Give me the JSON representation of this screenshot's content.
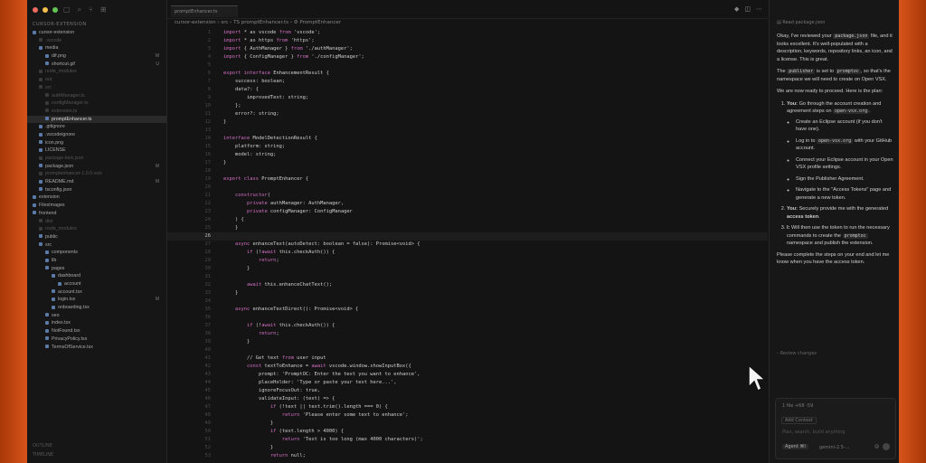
{
  "explorer": {
    "header": "CURSOR-EXTENSION",
    "root": "cursor-extension",
    "items": [
      {
        "label": "cursor-extension",
        "indent": 0,
        "dim": false,
        "badge": "",
        "sel": false
      },
      {
        "label": ".vscode",
        "indent": 1,
        "dim": true,
        "badge": "",
        "sel": false
      },
      {
        "label": "media",
        "indent": 1,
        "dim": false,
        "badge": "",
        "sel": false
      },
      {
        "label": "dif.png",
        "indent": 2,
        "dim": false,
        "badge": "M",
        "sel": false
      },
      {
        "label": "shortcut.gif",
        "indent": 2,
        "dim": false,
        "badge": "U",
        "sel": false
      },
      {
        "label": "node_modules",
        "indent": 1,
        "dim": true,
        "badge": "",
        "sel": false
      },
      {
        "label": "out",
        "indent": 1,
        "dim": true,
        "badge": "",
        "sel": false
      },
      {
        "label": "src",
        "indent": 1,
        "dim": true,
        "badge": "",
        "sel": false
      },
      {
        "label": "authManager.ts",
        "indent": 2,
        "dim": true,
        "badge": "",
        "sel": false
      },
      {
        "label": "configManager.ts",
        "indent": 2,
        "dim": true,
        "badge": "",
        "sel": false
      },
      {
        "label": "extension.ts",
        "indent": 2,
        "dim": true,
        "badge": "",
        "sel": false
      },
      {
        "label": "promptEnhancer.ts",
        "indent": 2,
        "dim": false,
        "badge": "",
        "sel": true
      },
      {
        "label": ".gitignore",
        "indent": 1,
        "dim": false,
        "badge": "",
        "sel": false
      },
      {
        "label": ".vscodeignore",
        "indent": 1,
        "dim": false,
        "badge": "",
        "sel": false
      },
      {
        "label": "icon.png",
        "indent": 1,
        "dim": false,
        "badge": "",
        "sel": false
      },
      {
        "label": "LICENSE",
        "indent": 1,
        "dim": false,
        "badge": "",
        "sel": false
      },
      {
        "label": "package-lock.json",
        "indent": 1,
        "dim": true,
        "badge": "",
        "sel": false
      },
      {
        "label": "package.json",
        "indent": 1,
        "dim": false,
        "badge": "M",
        "sel": false
      },
      {
        "label": "promptenhancer-1.0.0.vsix",
        "indent": 1,
        "dim": true,
        "badge": "",
        "sel": false
      },
      {
        "label": "README.md",
        "indent": 1,
        "dim": false,
        "badge": "M",
        "sel": false
      },
      {
        "label": "tsconfig.json",
        "indent": 1,
        "dim": false,
        "badge": "",
        "sel": false
      },
      {
        "label": "extension",
        "indent": 0,
        "dim": false,
        "badge": "",
        "sel": false
      },
      {
        "label": "FilesImages",
        "indent": 0,
        "dim": false,
        "badge": "",
        "sel": false
      },
      {
        "label": "frontend",
        "indent": 0,
        "dim": false,
        "badge": "",
        "sel": false
      },
      {
        "label": "dist",
        "indent": 1,
        "dim": true,
        "badge": "",
        "sel": false
      },
      {
        "label": "node_modules",
        "indent": 1,
        "dim": true,
        "badge": "",
        "sel": false
      },
      {
        "label": "public",
        "indent": 1,
        "dim": false,
        "badge": "",
        "sel": false
      },
      {
        "label": "src",
        "indent": 1,
        "dim": false,
        "badge": "",
        "sel": false
      },
      {
        "label": "components",
        "indent": 2,
        "dim": false,
        "badge": "",
        "sel": false
      },
      {
        "label": "lib",
        "indent": 2,
        "dim": false,
        "badge": "",
        "sel": false
      },
      {
        "label": "pages",
        "indent": 2,
        "dim": false,
        "badge": "",
        "sel": false
      },
      {
        "label": "dashboard",
        "indent": 3,
        "dim": false,
        "badge": "",
        "sel": false
      },
      {
        "label": "account",
        "indent": 4,
        "dim": false,
        "badge": "",
        "sel": false
      },
      {
        "label": "account.tsx",
        "indent": 3,
        "dim": false,
        "badge": "",
        "sel": false
      },
      {
        "label": "login.tsx",
        "indent": 3,
        "dim": false,
        "badge": "M",
        "sel": false
      },
      {
        "label": "onboarding.tsx",
        "indent": 3,
        "dim": false,
        "badge": "",
        "sel": false
      },
      {
        "label": "seo",
        "indent": 2,
        "dim": false,
        "badge": "",
        "sel": false
      },
      {
        "label": "index.tsx",
        "indent": 2,
        "dim": false,
        "badge": "",
        "sel": false
      },
      {
        "label": "NotFound.tsx",
        "indent": 2,
        "dim": false,
        "badge": "",
        "sel": false
      },
      {
        "label": "PrivacyPolicy.tsx",
        "indent": 2,
        "dim": false,
        "badge": "",
        "sel": false
      },
      {
        "label": "TermsOfService.tsx",
        "indent": 2,
        "dim": false,
        "badge": "",
        "sel": false
      }
    ],
    "outline": "OUTLINE",
    "timeline": "TIMELINE"
  },
  "editor": {
    "tab_label": "promptEnhancer.ts",
    "breadcrumb": "cursor-extension › src › TS promptEnhancer.ts › ⚙ PromptEnhancer",
    "active_line": "26",
    "lines": [
      {
        "n": "1",
        "t": "import * as vscode from 'vscode';"
      },
      {
        "n": "2",
        "t": "import * as https from 'https';"
      },
      {
        "n": "3",
        "t": "import { AuthManager } from './authManager';"
      },
      {
        "n": "4",
        "t": "import { ConfigManager } from './configManager';"
      },
      {
        "n": "5",
        "t": ""
      },
      {
        "n": "6",
        "t": "export interface EnhancementResult {"
      },
      {
        "n": "7",
        "t": "    success: boolean;"
      },
      {
        "n": "8",
        "t": "    data?: {"
      },
      {
        "n": "9",
        "t": "        improvedText: string;"
      },
      {
        "n": "10",
        "t": "    };"
      },
      {
        "n": "11",
        "t": "    error?: string;"
      },
      {
        "n": "12",
        "t": "}"
      },
      {
        "n": "13",
        "t": ""
      },
      {
        "n": "14",
        "t": "interface ModelDetectionResult {"
      },
      {
        "n": "15",
        "t": "    platform: string;"
      },
      {
        "n": "16",
        "t": "    model: string;"
      },
      {
        "n": "17",
        "t": "}"
      },
      {
        "n": "18",
        "t": ""
      },
      {
        "n": "19",
        "t": "export class PromptEnhancer {"
      },
      {
        "n": "20",
        "t": ""
      },
      {
        "n": "21",
        "t": "    constructor("
      },
      {
        "n": "22",
        "t": "        private authManager: AuthManager,"
      },
      {
        "n": "23",
        "t": "        private configManager: ConfigManager"
      },
      {
        "n": "24",
        "t": "    ) {"
      },
      {
        "n": "25",
        "t": "    }"
      },
      {
        "n": "26",
        "t": ""
      },
      {
        "n": "27",
        "t": "    async enhanceText(autoDetect: boolean = false): Promise<void> {"
      },
      {
        "n": "28",
        "t": "        if (!await this.checkAuth()) {"
      },
      {
        "n": "29",
        "t": "            return;"
      },
      {
        "n": "30",
        "t": "        }"
      },
      {
        "n": "31",
        "t": ""
      },
      {
        "n": "32",
        "t": "        await this.enhanceChatText();"
      },
      {
        "n": "33",
        "t": "    }"
      },
      {
        "n": "34",
        "t": ""
      },
      {
        "n": "35",
        "t": "    async enhanceTextDirect(): Promise<void> {"
      },
      {
        "n": "36",
        "t": ""
      },
      {
        "n": "37",
        "t": "        if (!await this.checkAuth()) {"
      },
      {
        "n": "38",
        "t": "            return;"
      },
      {
        "n": "39",
        "t": "        }"
      },
      {
        "n": "40",
        "t": ""
      },
      {
        "n": "41",
        "t": "        // Get text from user input"
      },
      {
        "n": "42",
        "t": "        const textToEnhance = await vscode.window.showInputBox({"
      },
      {
        "n": "43",
        "t": "            prompt: 'PromptOC: Enter the text you want to enhance',"
      },
      {
        "n": "44",
        "t": "            placeHolder: 'Type or paste your text here...',"
      },
      {
        "n": "45",
        "t": "            ignoreFocusOut: true,"
      },
      {
        "n": "46",
        "t": "            validateInput: (text) => {"
      },
      {
        "n": "47",
        "t": "                if (!text || text.trim().length === 0) {"
      },
      {
        "n": "48",
        "t": "                    return 'Please enter some text to enhance';"
      },
      {
        "n": "49",
        "t": "                }"
      },
      {
        "n": "50",
        "t": "                if (text.length > 4000) {"
      },
      {
        "n": "51",
        "t": "                    return 'Text is too long (max 4000 characters)';"
      },
      {
        "n": "52",
        "t": "                }"
      },
      {
        "n": "53",
        "t": "                return null;"
      }
    ]
  },
  "chat": {
    "header": "Read package.json",
    "p1_a": "Okay, I've reviewed your ",
    "p1_code": "package.json",
    "p1_b": " file, and it looks excellent. It's well-populated with a description, keywords, repository links, an icon, and a license. This is great.",
    "p2_a": "The ",
    "p2_code": "publisher",
    "p2_b": " is set to ",
    "p2_code2": "promptoc",
    "p2_c": ", so that's the namespace we will need to create on Open VSX.",
    "p3": "We are now ready to proceed. Here is the plan:",
    "step1_bold": "You:",
    "step1_a": " Go through the account creation and agreement steps on ",
    "step1_code": "open-vsx.org",
    "step1_b": ".",
    "sub1": "Create an Eclipse account (if you don't have one).",
    "sub2_a": "Log in to ",
    "sub2_code": "open-vsx.org",
    "sub2_b": " with your GitHub account.",
    "sub3": "Connect your Eclipse account in your Open VSX profile settings.",
    "sub4": "Sign the Publisher Agreement.",
    "sub5": "Navigate to the \"Access Tokens\" page and generate a new token.",
    "step2_bold": "You:",
    "step2_a": " Securely provide me with the generated ",
    "step2_code": "access token",
    "step2_b": ".",
    "step3_bold": "I:",
    "step3_a": " Will then use the token to run the necessary commands to create the ",
    "step3_code": "promptoc",
    "step3_b": " namespace and publish the extension.",
    "p4": "Please complete the steps on your end and let me know when you have the access token.",
    "review": "Review changes",
    "files": "1 file +68 -59",
    "add_context": "Add Context",
    "placeholder": "Plan, search, build anything",
    "mode": "Agent ⌘I",
    "model": "gemini-2.5-...",
    "at": "@"
  },
  "colors": {
    "bg": "#141414",
    "sidebar": "#161616",
    "selected": "#2a2a2a",
    "keyword": "#d46fc4",
    "wallpaper": "#d8541a"
  }
}
